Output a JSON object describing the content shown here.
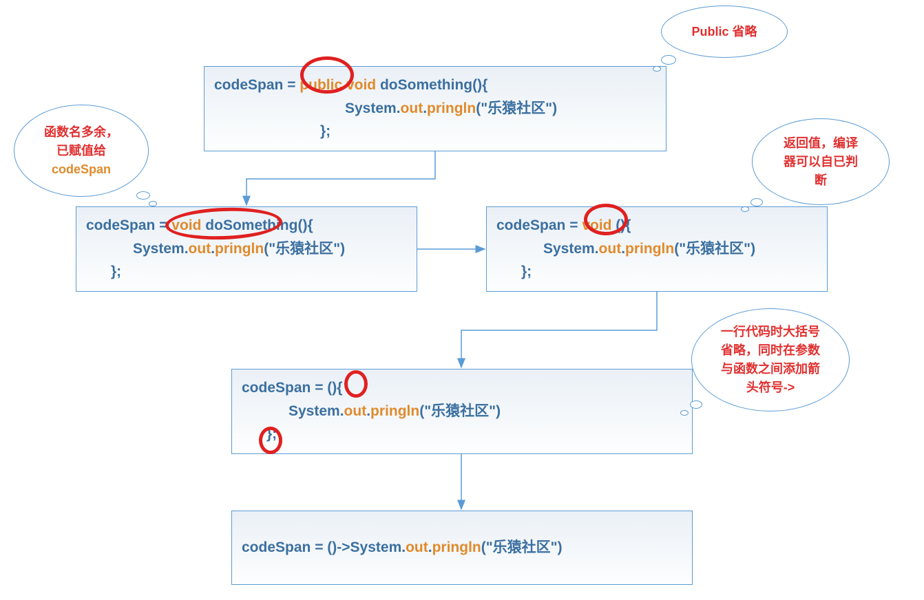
{
  "boxes": {
    "box1": {
      "line1_a": "codeSpan = ",
      "line1_b": "public void",
      "line1_c": " doSomething(){",
      "line2_a": "System.",
      "line2_b": "out",
      "line2_c": ".",
      "line2_d": "pringln",
      "line2_e": "(\"乐猿社区\")",
      "line3": "};"
    },
    "box2": {
      "line1_a": "codeSpan = ",
      "line1_b": "void",
      "line1_c": " doSomething(){",
      "line2_a": "System.",
      "line2_b": "out",
      "line2_c": ".",
      "line2_d": "pringln",
      "line2_e": "(\"乐猿社区\")",
      "line3": "};"
    },
    "box3": {
      "line1_a": "codeSpan = ",
      "line1_b": "void",
      "line1_c": " (){",
      "line2_a": "System.",
      "line2_b": "out",
      "line2_c": ".",
      "line2_d": "pringln",
      "line2_e": "(\"乐猿社区\")",
      "line3": "};"
    },
    "box4": {
      "line1_a": "codeSpan = (",
      "line1_b": "){",
      "line2_a": "System.",
      "line2_b": "out",
      "line2_c": ".",
      "line2_d": "pringln",
      "line2_e": "(\"乐猿社区\")",
      "line3": "};"
    },
    "box5": {
      "line1_a": "codeSpan = ()->System.",
      "line1_b": "out",
      "line1_c": ".",
      "line1_d": "pringln",
      "line1_e": "(\"乐猿社区\")"
    }
  },
  "callouts": {
    "c1": "Public 省略",
    "c2_l1": "函数名多余，",
    "c2_l2": "已赋值给",
    "c2_l3": "codeSpan",
    "c3_l1": "返回值，编译",
    "c3_l2": "器可以自已判",
    "c3_l3": "断",
    "c4_l1": "一行代码时大括号",
    "c4_l2": "省略，同时在参数",
    "c4_l3": "与函数之间添加箭",
    "c4_l4": "头符号->"
  }
}
